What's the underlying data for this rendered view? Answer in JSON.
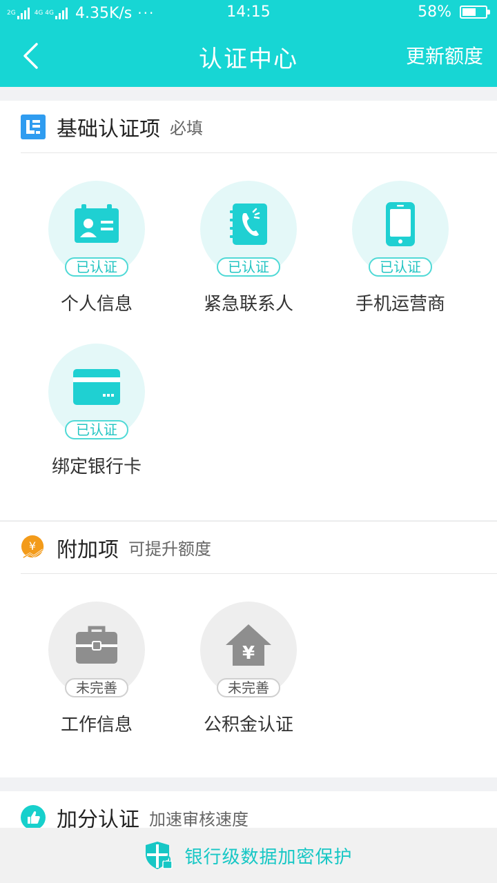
{
  "status_bar": {
    "net_1": "2G",
    "net_2": "4G 4G",
    "speed": "4.35K/s",
    "dots": "···",
    "time": "14:15",
    "battery_percent": "58%",
    "battery_level": 0.58
  },
  "header": {
    "title": "认证中心",
    "update_label": "更新额度"
  },
  "basic_section": {
    "title": "基础认证项",
    "subtitle": "必填",
    "items": [
      {
        "label": "个人信息",
        "status": "已认证",
        "icon": "id-card-icon"
      },
      {
        "label": "紧急联系人",
        "status": "已认证",
        "icon": "contact-book-icon"
      },
      {
        "label": "手机运营商",
        "status": "已认证",
        "icon": "mobile-phone-icon"
      },
      {
        "label": "绑定银行卡",
        "status": "已认证",
        "icon": "bank-card-icon"
      }
    ]
  },
  "extra_section": {
    "title": "附加项",
    "subtitle": "可提升额度",
    "items": [
      {
        "label": "工作信息",
        "status": "未完善",
        "icon": "briefcase-icon"
      },
      {
        "label": "公积金认证",
        "status": "未完善",
        "icon": "housing-fund-icon"
      }
    ]
  },
  "bonus_section": {
    "title": "加分认证",
    "subtitle": "加速审核速度"
  },
  "footer": {
    "text": "银行级数据加密保护"
  },
  "colors": {
    "primary": "#17d6d4",
    "accent_text": "#17c7c5",
    "verified_bg": "#e4f8f8",
    "pending_bg": "#eeeeee",
    "section_icon_blue": "#2f9cf0",
    "section_icon_orange": "#f39b1a"
  }
}
